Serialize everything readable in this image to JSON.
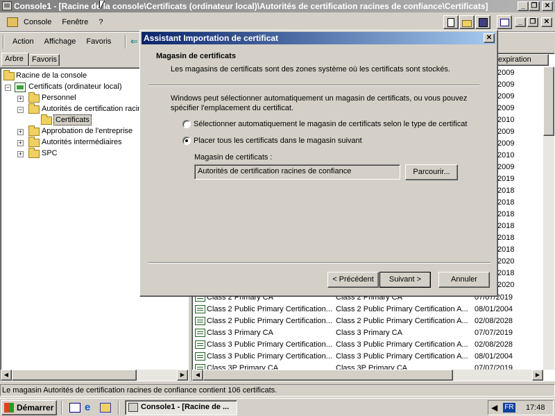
{
  "window": {
    "title": "Console1 - [Racine de la console\\Certificats (ordinateur local)\\Autorités de certification racines de confiance\\Certificats]",
    "minimize": "_",
    "restore": "❐",
    "close": "✕"
  },
  "menu_top": [
    "Console",
    "Fenêtre",
    "?"
  ],
  "menu_action": [
    "Action",
    "Affichage",
    "Favoris"
  ],
  "tabs": [
    "Arbre",
    "Favoris"
  ],
  "tree": [
    {
      "label": "Racine de la console"
    },
    {
      "label": "Certificats (ordinateur local)"
    },
    {
      "label": "Personnel"
    },
    {
      "label": "Autorités de certification racines de confiance"
    },
    {
      "label": "Certificats"
    },
    {
      "label": "Approbation de l'entreprise"
    },
    {
      "label": "Autorités intermédiaires"
    },
    {
      "label": "SPC"
    }
  ],
  "list": {
    "header_expiration": "expiration",
    "partial_dates": [
      "2009",
      "2009",
      "2009",
      "2009",
      "2010",
      "2009",
      "2009",
      "2010",
      "2009",
      "2019",
      "2018",
      "2018",
      "2018",
      "2018",
      "2018",
      "2018",
      "2020",
      "2018",
      "2020"
    ],
    "rows": [
      [
        "Class 2 Primary CA",
        "Class 2 Primary CA",
        "07/07/2019"
      ],
      [
        "Class 2 Public Primary Certification...",
        "Class 2 Public Primary Certification A...",
        "08/01/2004"
      ],
      [
        "Class 2 Public Primary Certification...",
        "Class 2 Public Primary Certification A...",
        "02/08/2028"
      ],
      [
        "Class 3 Primary CA",
        "Class 3 Primary CA",
        "07/07/2019"
      ],
      [
        "Class 3 Public Primary Certification...",
        "Class 3 Public Primary Certification A...",
        "02/08/2028"
      ],
      [
        "Class 3 Public Primary Certification...",
        "Class 3 Public Primary Certification A...",
        "08/01/2004"
      ],
      [
        "Class 3P Primary CA",
        "Class 3P Primary CA",
        "07/07/2019"
      ]
    ]
  },
  "status": "Le magasin Autorités de certification racines de confiance contient 106 certificats.",
  "dialog": {
    "title": "Assistant Importation de certificat",
    "heading": "Magasin de certificats",
    "subheading": "Les magasins de certificats sont des zones système où les certificats sont stockés.",
    "intro_line1": "Windows peut sélectionner automatiquement un magasin de certificats, ou vous pouvez",
    "intro_line2": "spécifier l'emplacement du certificat.",
    "radio_auto": "Sélectionner automatiquement le magasin de certificats selon le type de certificat",
    "radio_manual": "Placer tous les certificats dans le magasin suivant",
    "store_label": "Magasin de certificats :",
    "store_value": "Autorités de certification racines de confiance",
    "browse": "Parcourir...",
    "back": "< Précédent",
    "next": "Suivant >",
    "cancel": "Annuler"
  },
  "taskbar": {
    "start": "Démarrer",
    "task": "Console1 - [Racine de ...",
    "lang": "FR",
    "clock": "17:48"
  }
}
